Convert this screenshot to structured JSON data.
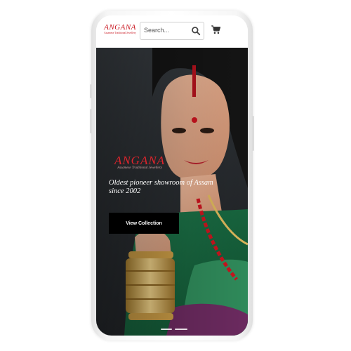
{
  "header": {
    "logo_title": "ANGANA",
    "logo_subtitle": "Assamese Traditional Jewellery",
    "search_placeholder": "Search...",
    "search_icon": "search-icon",
    "cart_icon": "cart-icon"
  },
  "hero": {
    "brand_title": "ANGANA",
    "brand_subtitle": "Assamese Traditional Jewellery",
    "tagline": "Oldest pioneer showroom of Assam since 2002",
    "cta_label": "View Collection"
  },
  "colors": {
    "brand_red": "#c8141e",
    "cta_background": "#000000",
    "cta_text": "#ffffff"
  }
}
